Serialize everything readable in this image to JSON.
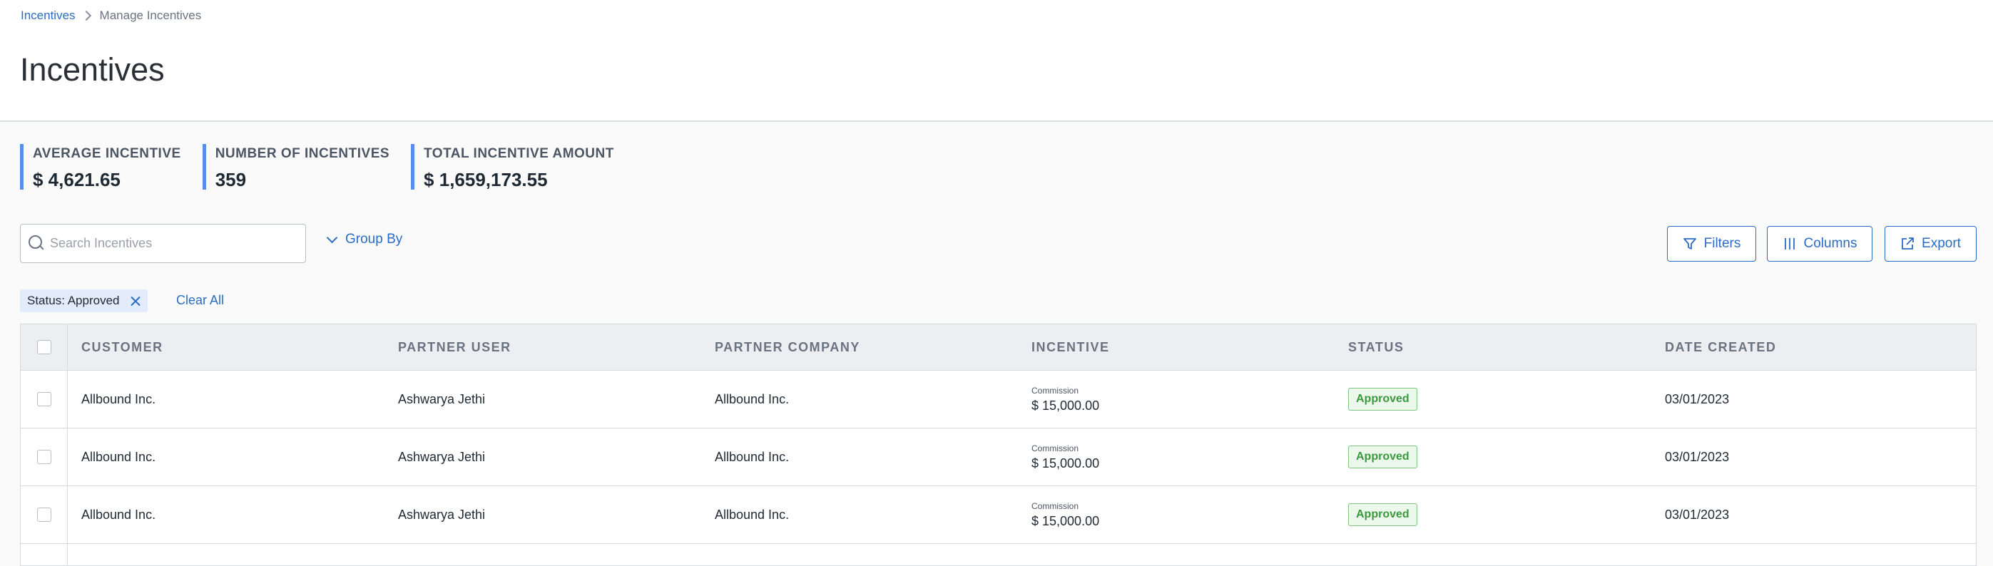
{
  "breadcrumb": {
    "root": "Incentives",
    "current": "Manage Incentives"
  },
  "page_title": "Incentives",
  "stats": [
    {
      "label": "AVERAGE INCENTIVE",
      "value": "$ 4,621.65"
    },
    {
      "label": "NUMBER OF INCENTIVES",
      "value": "359"
    },
    {
      "label": "TOTAL INCENTIVE AMOUNT",
      "value": "$ 1,659,173.55"
    }
  ],
  "search": {
    "placeholder": "Search Incentives",
    "value": ""
  },
  "group_by_label": "Group By",
  "toolbar": {
    "filters_label": "Filters",
    "columns_label": "Columns",
    "export_label": "Export"
  },
  "active_filter": {
    "label": "Status: Approved"
  },
  "clear_all_label": "Clear All",
  "table": {
    "columns": [
      "CUSTOMER",
      "PARTNER USER",
      "PARTNER COMPANY",
      "INCENTIVE",
      "STATUS",
      "DATE CREATED"
    ],
    "rows": [
      {
        "customer": "Allbound Inc.",
        "partner_user": "Ashwarya Jethi",
        "partner_company": "Allbound Inc.",
        "incentive_type": "Commission",
        "incentive_amount": "$ 15,000.00",
        "status": "Approved",
        "date_created": "03/01/2023"
      },
      {
        "customer": "Allbound Inc.",
        "partner_user": "Ashwarya Jethi",
        "partner_company": "Allbound Inc.",
        "incentive_type": "Commission",
        "incentive_amount": "$ 15,000.00",
        "status": "Approved",
        "date_created": "03/01/2023"
      },
      {
        "customer": "Allbound Inc.",
        "partner_user": "Ashwarya Jethi",
        "partner_company": "Allbound Inc.",
        "incentive_type": "Commission",
        "incentive_amount": "$ 15,000.00",
        "status": "Approved",
        "date_created": "03/01/2023"
      }
    ]
  },
  "colors": {
    "accent": "#2b6cc6",
    "stat_bar": "#5b8def",
    "approved_text": "#3a9a3d",
    "approved_bg": "#ecf8ec"
  }
}
